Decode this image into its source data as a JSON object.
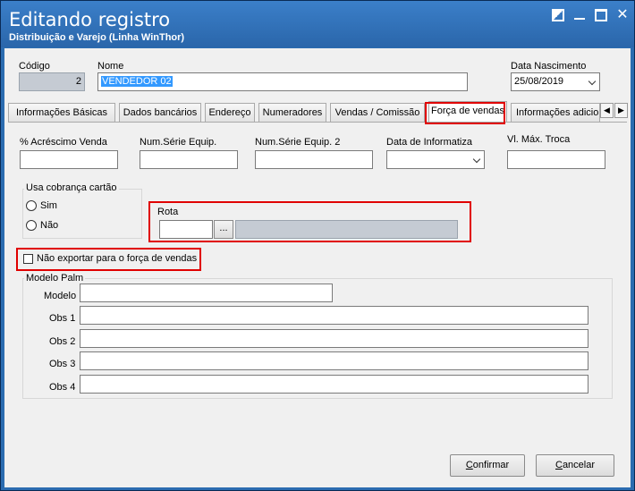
{
  "window": {
    "title": "Editando registro",
    "subtitle": "Distribuição e Varejo (Linha WinThor)"
  },
  "header": {
    "codigo_label": "Código",
    "codigo_value": "2",
    "nome_label": "Nome",
    "nome_value": "VENDEDOR 02",
    "nascimento_label": "Data Nascimento",
    "nascimento_value": "25/08/2019"
  },
  "tabs": [
    {
      "label": "Informações Básicas"
    },
    {
      "label": "Dados bancários"
    },
    {
      "label": "Endereço"
    },
    {
      "label": "Numeradores"
    },
    {
      "label": "Vendas  / Comissão"
    },
    {
      "label": "Força de vendas",
      "active": true
    },
    {
      "label": "Informações adicio"
    }
  ],
  "form": {
    "acrescimo_label": "% Acréscimo Venda",
    "num_serie_label": "Num.Série Equip.",
    "num_serie2_label": "Num.Série Equip. 2",
    "data_informatiza_label": "Data de Informatiza",
    "vl_max_troca_label": "Vl. Máx. Troca",
    "cobranca": {
      "title": "Usa cobrança cartão",
      "sim": "Sim",
      "nao": "Não"
    },
    "rota_label": "Rota",
    "rota_button": "...",
    "nao_exportar_label": "Não exportar para o força de vendas",
    "modelo_palm": {
      "title": "Modelo Palm",
      "modelo_label": "Modelo",
      "obs1_label": "Obs 1",
      "obs2_label": "Obs 2",
      "obs3_label": "Obs 3",
      "obs4_label": "Obs 4"
    }
  },
  "buttons": {
    "confirmar_first": "C",
    "confirmar_rest": "onfirmar",
    "cancelar_first": "C",
    "cancelar_rest": "ancelar"
  },
  "colors": {
    "highlight": "#e00000",
    "titlebar": "#2a66aa",
    "selection": "#3399ff"
  }
}
